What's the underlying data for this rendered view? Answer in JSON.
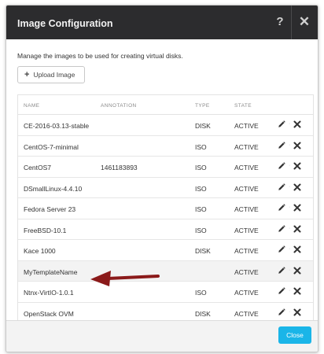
{
  "dialog": {
    "title": "Image Configuration",
    "help_glyph": "?",
    "close_glyph": "✕",
    "description": "Manage the images to be used for creating virtual disks.",
    "upload_label": "Upload Image",
    "close_label": "Close"
  },
  "table": {
    "headers": {
      "name": "NAME",
      "annotation": "ANNOTATION",
      "type": "TYPE",
      "state": "STATE"
    },
    "rows": [
      {
        "name": "CE-2016-03.13-stable",
        "annotation": "",
        "type": "DISK",
        "state": "ACTIVE"
      },
      {
        "name": "CentOS-7-minimal",
        "annotation": "",
        "type": "ISO",
        "state": "ACTIVE"
      },
      {
        "name": "CentOS7",
        "annotation": "1461183893",
        "type": "ISO",
        "state": "ACTIVE"
      },
      {
        "name": "DSmallLinux-4.4.10",
        "annotation": "",
        "type": "ISO",
        "state": "ACTIVE"
      },
      {
        "name": "Fedora Server 23",
        "annotation": "",
        "type": "ISO",
        "state": "ACTIVE"
      },
      {
        "name": "FreeBSD-10.1",
        "annotation": "",
        "type": "ISO",
        "state": "ACTIVE"
      },
      {
        "name": "Kace 1000",
        "annotation": "",
        "type": "DISK",
        "state": "ACTIVE"
      },
      {
        "name": "MyTemplateName",
        "annotation": "",
        "type": "",
        "state": "ACTIVE"
      },
      {
        "name": "Ntnx-VirtIO-1.0.1",
        "annotation": "",
        "type": "ISO",
        "state": "ACTIVE"
      },
      {
        "name": "OpenStack OVM",
        "annotation": "",
        "type": "DISK",
        "state": "ACTIVE"
      }
    ]
  },
  "colors": {
    "header_bg": "#2c2c2e",
    "accent": "#1ab5e8",
    "arrow": "#8b1a1a",
    "highlight_row": "#f3f3f3"
  },
  "icons": [
    "help-icon",
    "close-icon",
    "plus-icon",
    "pencil-icon",
    "delete-icon",
    "callout-arrow"
  ]
}
